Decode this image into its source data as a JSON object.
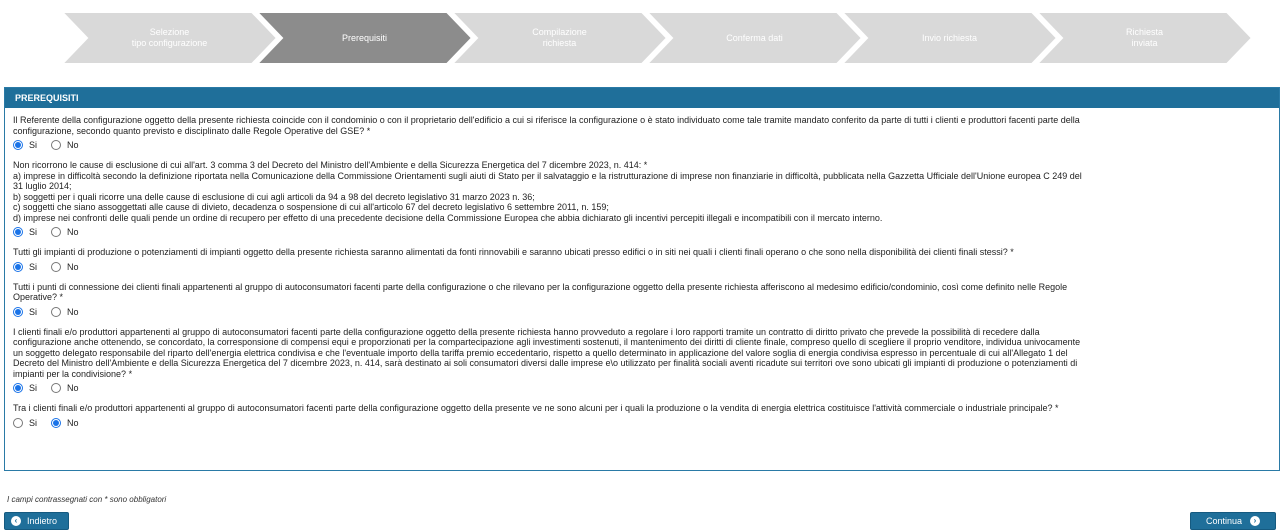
{
  "wizard": {
    "steps": [
      {
        "label": "Selezione\ntipo configurazione",
        "active": false
      },
      {
        "label": "Prerequisiti",
        "active": true
      },
      {
        "label": "Compilazione\nrichiesta",
        "active": false
      },
      {
        "label": "Conferma dati",
        "active": false
      },
      {
        "label": "Invio richiesta",
        "active": false
      },
      {
        "label": "Richiesta\ninviata",
        "active": false
      }
    ]
  },
  "panel": {
    "title": "PREREQUISITI",
    "questions": [
      {
        "text": "Il Referente della configurazione oggetto della presente richiesta coincide con il condominio o con il proprietario dell'edificio a cui si riferisce la configurazione o è stato individuato come tale tramite mandato conferito da parte di tutti i clienti e produttori facenti parte della\nconfigurazione, secondo quanto previsto e disciplinato dalle Regole Operative del GSE? *",
        "selected": "Si"
      },
      {
        "text": "Non ricorrono le cause di esclusione di cui all'art. 3 comma 3 del Decreto del Ministro dell'Ambiente e della Sicurezza Energetica del 7 dicembre 2023, n. 414: *\na) imprese in difficoltà secondo la definizione riportata nella Comunicazione della Commissione Orientamenti sugli aiuti di Stato per il salvataggio e la ristrutturazione di imprese non finanziarie in difficoltà, pubblicata nella Gazzetta Ufficiale dell'Unione europea C 249 del\n31 luglio 2014;\nb) soggetti per i quali ricorre una delle cause di esclusione di cui agli articoli da 94 a 98 del decreto legislativo 31 marzo 2023 n. 36;\nc) soggetti che siano assoggettati alle cause di divieto, decadenza o sospensione di cui all'articolo 67 del decreto legislativo 6 settembre 2011, n. 159;\nd) imprese nei confronti delle quali pende un ordine di recupero per effetto di una precedente decisione della Commissione Europea che abbia dichiarato gli incentivi percepiti illegali e incompatibili con il mercato interno.",
        "selected": "Si"
      },
      {
        "text": "Tutti gli impianti di produzione o potenziamenti di impianti oggetto della presente richiesta saranno alimentati da fonti rinnovabili e saranno ubicati presso edifici o in siti nei quali i clienti finali operano o che sono nella disponibilità dei clienti finali stessi? *",
        "selected": "Si"
      },
      {
        "text": "Tutti i punti di connessione dei clienti finali appartenenti al gruppo di autoconsumatori facenti parte della configurazione o che rilevano per la configurazione oggetto della presente richiesta afferiscono al medesimo edificio/condominio, così come definito nelle Regole\nOperative? *",
        "selected": "Si"
      },
      {
        "text": "I clienti finali e/o produttori appartenenti al gruppo di autoconsumatori facenti parte della configurazione oggetto della presente richiesta hanno provveduto a regolare i loro rapporti tramite un contratto di diritto privato che prevede la possibilità di recedere dalla\nconfigurazione anche ottenendo, se concordato, la corresponsione di compensi equi e proporzionati per la compartecipazione agli investimenti sostenuti, il mantenimento dei diritti di cliente finale, compreso quello di scegliere il proprio venditore, individua univocamente\nun soggetto delegato responsabile del riparto dell'energia elettrica condivisa e che l'eventuale importo della tariffa premio eccedentario, rispetto a quello determinato in applicazione del valore soglia di energia condivisa espresso in percentuale di cui all'Allegato 1 del\nDecreto del Ministro dell'Ambiente e della Sicurezza Energetica del 7 dicembre 2023, n. 414, sarà destinato ai soli consumatori diversi dalle imprese e\\o utilizzato per finalità sociali aventi ricadute sui territori ove sono ubicati gli impianti di produzione o potenziamenti di\nimpianti per la condivisione? *",
        "selected": "Si"
      },
      {
        "text": "Tra i clienti finali e/o produttori appartenenti al gruppo di autoconsumatori facenti parte della configurazione oggetto della presente ve ne sono alcuni per i quali la produzione o la vendita di energia elettrica costituisce l'attività commerciale o industriale principale? *",
        "selected": "No"
      }
    ],
    "options": {
      "yes": "Si",
      "no": "No"
    }
  },
  "footer": {
    "required_note": "I campi contrassegnati con * sono obbligatori",
    "back_label": "Indietro",
    "next_label": "Continua"
  },
  "colors": {
    "step_inactive": "#d9d9d9",
    "step_active": "#8c8c8c",
    "header": "#1f6f9a",
    "radio": "#1a73e8"
  }
}
